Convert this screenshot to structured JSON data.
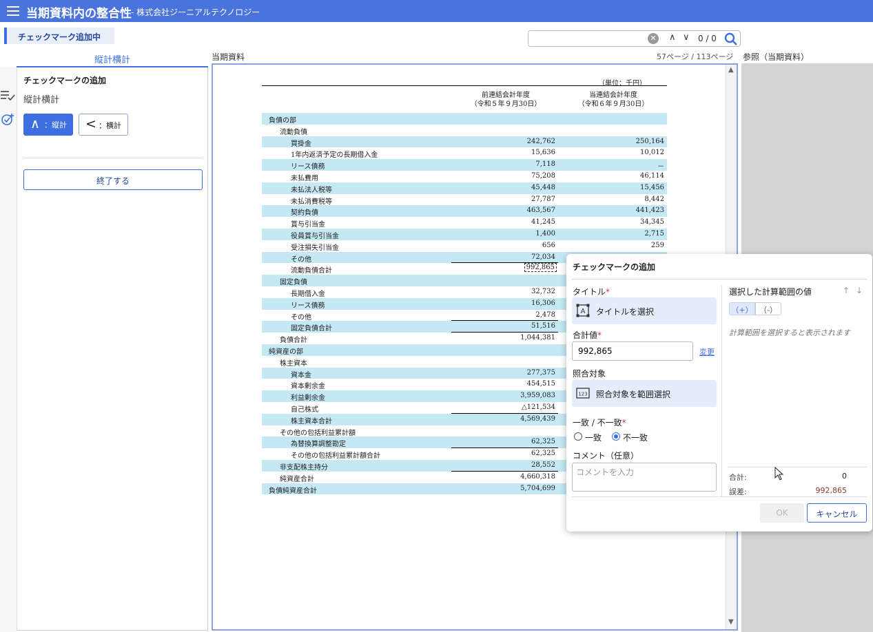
{
  "header": {
    "title": "当期資料内の整合性",
    "company": "- 株式会社ジーニアルテクノロジー"
  },
  "mode_badge": "チェックマーク追加中",
  "search": {
    "value": "",
    "count": "0 / 0"
  },
  "tabs": {
    "vertical": "縦計横計"
  },
  "doc_label": "当期資料",
  "page_info": "57ページ / 113ページ",
  "ref_label": "参照（当期資料）",
  "left_panel": {
    "heading": "チェックマークの追加",
    "sub": "縦計横計",
    "vsum_glyph": "∧",
    "vsum_label": "：縦計",
    "hsum_glyph": "<",
    "hsum_label": "：横計",
    "end_button": "終了する"
  },
  "document": {
    "unit": "（単位：千円）",
    "col1": [
      "前連結会計年度",
      "（令和５年９月30日）"
    ],
    "col2": [
      "当連結会計年度",
      "（令和６年９月30日）"
    ],
    "rows": [
      {
        "label": "負債の部",
        "indent": 0,
        "v1": "",
        "v2": "",
        "shade": true
      },
      {
        "label": "流動負債",
        "indent": 1,
        "v1": "",
        "v2": "",
        "shade": false
      },
      {
        "label": "買掛金",
        "indent": 2,
        "v1": "242,762",
        "v2": "250,164",
        "shade": true
      },
      {
        "label": "1年内返済予定の長期借入金",
        "indent": 2,
        "v1": "15,636",
        "v2": "10,012",
        "shade": false
      },
      {
        "label": "リース債務",
        "indent": 2,
        "v1": "7,118",
        "v2": "－",
        "shade": true
      },
      {
        "label": "未払費用",
        "indent": 2,
        "v1": "75,208",
        "v2": "46,114",
        "shade": false
      },
      {
        "label": "未払法人税等",
        "indent": 2,
        "v1": "45,448",
        "v2": "15,456",
        "shade": true
      },
      {
        "label": "未払消費税等",
        "indent": 2,
        "v1": "27,787",
        "v2": "8,442",
        "shade": false
      },
      {
        "label": "契約負債",
        "indent": 2,
        "v1": "463,567",
        "v2": "441,423",
        "shade": true
      },
      {
        "label": "賞与引当金",
        "indent": 2,
        "v1": "41,245",
        "v2": "34,345",
        "shade": false
      },
      {
        "label": "役員賞与引当金",
        "indent": 2,
        "v1": "1,400",
        "v2": "2,715",
        "shade": true
      },
      {
        "label": "受注損失引当金",
        "indent": 2,
        "v1": "656",
        "v2": "259",
        "shade": false
      },
      {
        "label": "その他",
        "indent": 2,
        "v1": "72,034",
        "v2": "",
        "shade": true,
        "ul": true
      },
      {
        "label": "流動負債合計",
        "indent": 2,
        "v1": "992,865",
        "v2": "",
        "shade": false,
        "hl": true
      },
      {
        "label": "固定負債",
        "indent": 1,
        "v1": "",
        "v2": "",
        "shade": true
      },
      {
        "label": "長期借入金",
        "indent": 2,
        "v1": "32,732",
        "v2": "",
        "shade": false
      },
      {
        "label": "リース債務",
        "indent": 2,
        "v1": "16,306",
        "v2": "",
        "shade": true
      },
      {
        "label": "その他",
        "indent": 2,
        "v1": "2,478",
        "v2": "",
        "shade": false,
        "ul": true
      },
      {
        "label": "固定負債合計",
        "indent": 2,
        "v1": "51,516",
        "v2": "",
        "shade": true,
        "ul": true
      },
      {
        "label": "負債合計",
        "indent": 1,
        "v1": "1,044,381",
        "v2": "",
        "shade": false
      },
      {
        "label": "純資産の部",
        "indent": 0,
        "v1": "",
        "v2": "",
        "shade": true
      },
      {
        "label": "株主資本",
        "indent": 1,
        "v1": "",
        "v2": "",
        "shade": false
      },
      {
        "label": "資本金",
        "indent": 2,
        "v1": "277,375",
        "v2": "",
        "shade": true
      },
      {
        "label": "資本剰余金",
        "indent": 2,
        "v1": "454,515",
        "v2": "",
        "shade": false
      },
      {
        "label": "利益剰余金",
        "indent": 2,
        "v1": "3,959,083",
        "v2": "",
        "shade": true
      },
      {
        "label": "自己株式",
        "indent": 2,
        "v1": "△121,534",
        "v2": "",
        "shade": false,
        "ul": true
      },
      {
        "label": "株主資本合計",
        "indent": 2,
        "v1": "4,569,439",
        "v2": "",
        "shade": true
      },
      {
        "label": "その他の包括利益累計額",
        "indent": 1,
        "v1": "",
        "v2": "",
        "shade": false
      },
      {
        "label": "為替換算調整勘定",
        "indent": 2,
        "v1": "62,325",
        "v2": "",
        "shade": true,
        "ul": true
      },
      {
        "label": "その他の包括利益累計額合計",
        "indent": 2,
        "v1": "62,325",
        "v2": "",
        "shade": false
      },
      {
        "label": "非支配株主持分",
        "indent": 1,
        "v1": "28,552",
        "v2": "",
        "shade": true,
        "ul": true
      },
      {
        "label": "純資産合計",
        "indent": 1,
        "v1": "4,660,318",
        "v2": "",
        "shade": false
      },
      {
        "label": "負債純資産合計",
        "indent": 0,
        "v1": "5,704,699",
        "v2": "",
        "shade": true
      }
    ]
  },
  "dialog": {
    "title": "チェックマークの追加",
    "title_field_label": "タイトル",
    "title_select": "タイトルを選択",
    "total_label": "合計値",
    "total_value": "992,865",
    "change_link": "変更",
    "compare_label": "照合対象",
    "compare_select": "照合対象を範囲選択",
    "match_label": "一致 / 不一致",
    "match_option": "一致",
    "mismatch_option": "不一致",
    "comment_label": "コメント（任意）",
    "comment_placeholder": "コメントを入力",
    "range_label": "選択した計算範囲の値",
    "plus": "（+）",
    "minus": "（-）",
    "hint": "計算範囲を選択すると表示されます",
    "sum_label": "合計:",
    "sum_value": "0",
    "error_label": "誤差:",
    "error_value": "992,865",
    "ok": "OK",
    "cancel": "キャンセル"
  },
  "required_mark": "*",
  "colors": {
    "accent": "#3d6fe0",
    "header": "#4a74db",
    "row_shade": "#c4e8f4"
  }
}
